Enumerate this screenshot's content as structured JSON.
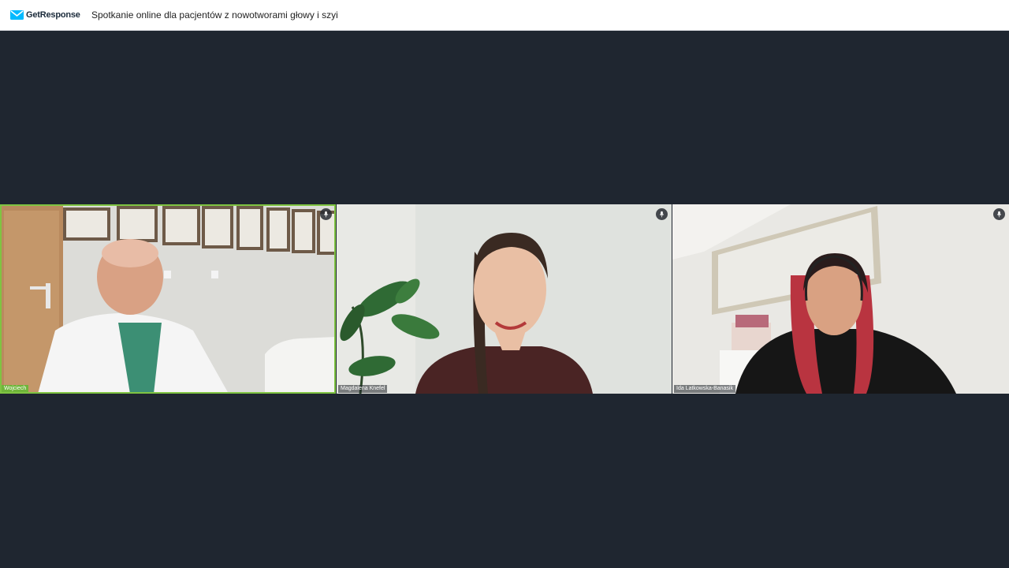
{
  "header": {
    "brand": "GetResponse",
    "brand_icon": "envelope-icon",
    "brand_color": "#00baff",
    "meeting_title": "Spotkanie online dla pacjentów z nowotworami głowy i szyi"
  },
  "participants": [
    {
      "name": "Wojciech",
      "active_speaker": true,
      "mic_icon": "microphone-icon"
    },
    {
      "name": "Magdalena Knefel",
      "active_speaker": false,
      "mic_icon": "microphone-icon"
    },
    {
      "name": "Ida Latkowska-Banasik",
      "active_speaker": false,
      "mic_icon": "microphone-icon"
    }
  ],
  "colors": {
    "stage_background": "#1f2630",
    "active_speaker_border": "#7fc442"
  }
}
